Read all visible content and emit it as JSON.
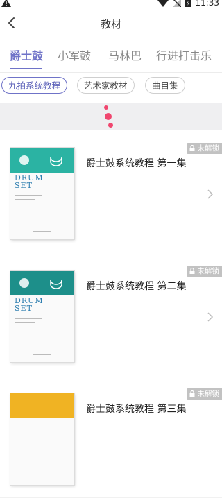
{
  "status_bar": {
    "time": "11:33"
  },
  "header": {
    "title": "教材"
  },
  "tabs": [
    {
      "label": "爵士鼓",
      "active": true
    },
    {
      "label": "小军鼓",
      "active": false
    },
    {
      "label": "马林巴",
      "active": false
    },
    {
      "label": "行进打击乐",
      "active": false
    }
  ],
  "chips": [
    {
      "label": "九拍系统教程",
      "active": true
    },
    {
      "label": "艺术家教材",
      "active": false
    },
    {
      "label": "曲目集",
      "active": false
    }
  ],
  "books": [
    {
      "title": "爵士鼓系统教程 第一集",
      "lock_label": "未解锁",
      "cover_color": "#2bb3a3",
      "cover_line1": "DRUM",
      "cover_line2": "SET"
    },
    {
      "title": "爵士鼓系统教程 第二集",
      "lock_label": "未解锁",
      "cover_color": "#1d8f8a",
      "cover_line1": "DRUM",
      "cover_line2": "SET"
    },
    {
      "title": "爵士鼓系统教程 第三集",
      "lock_label": "未解锁",
      "cover_color": "#f0b323",
      "cover_line1": "",
      "cover_line2": ""
    }
  ],
  "colors": {
    "accent": "#6f73c8",
    "loader": "#f0476f"
  }
}
